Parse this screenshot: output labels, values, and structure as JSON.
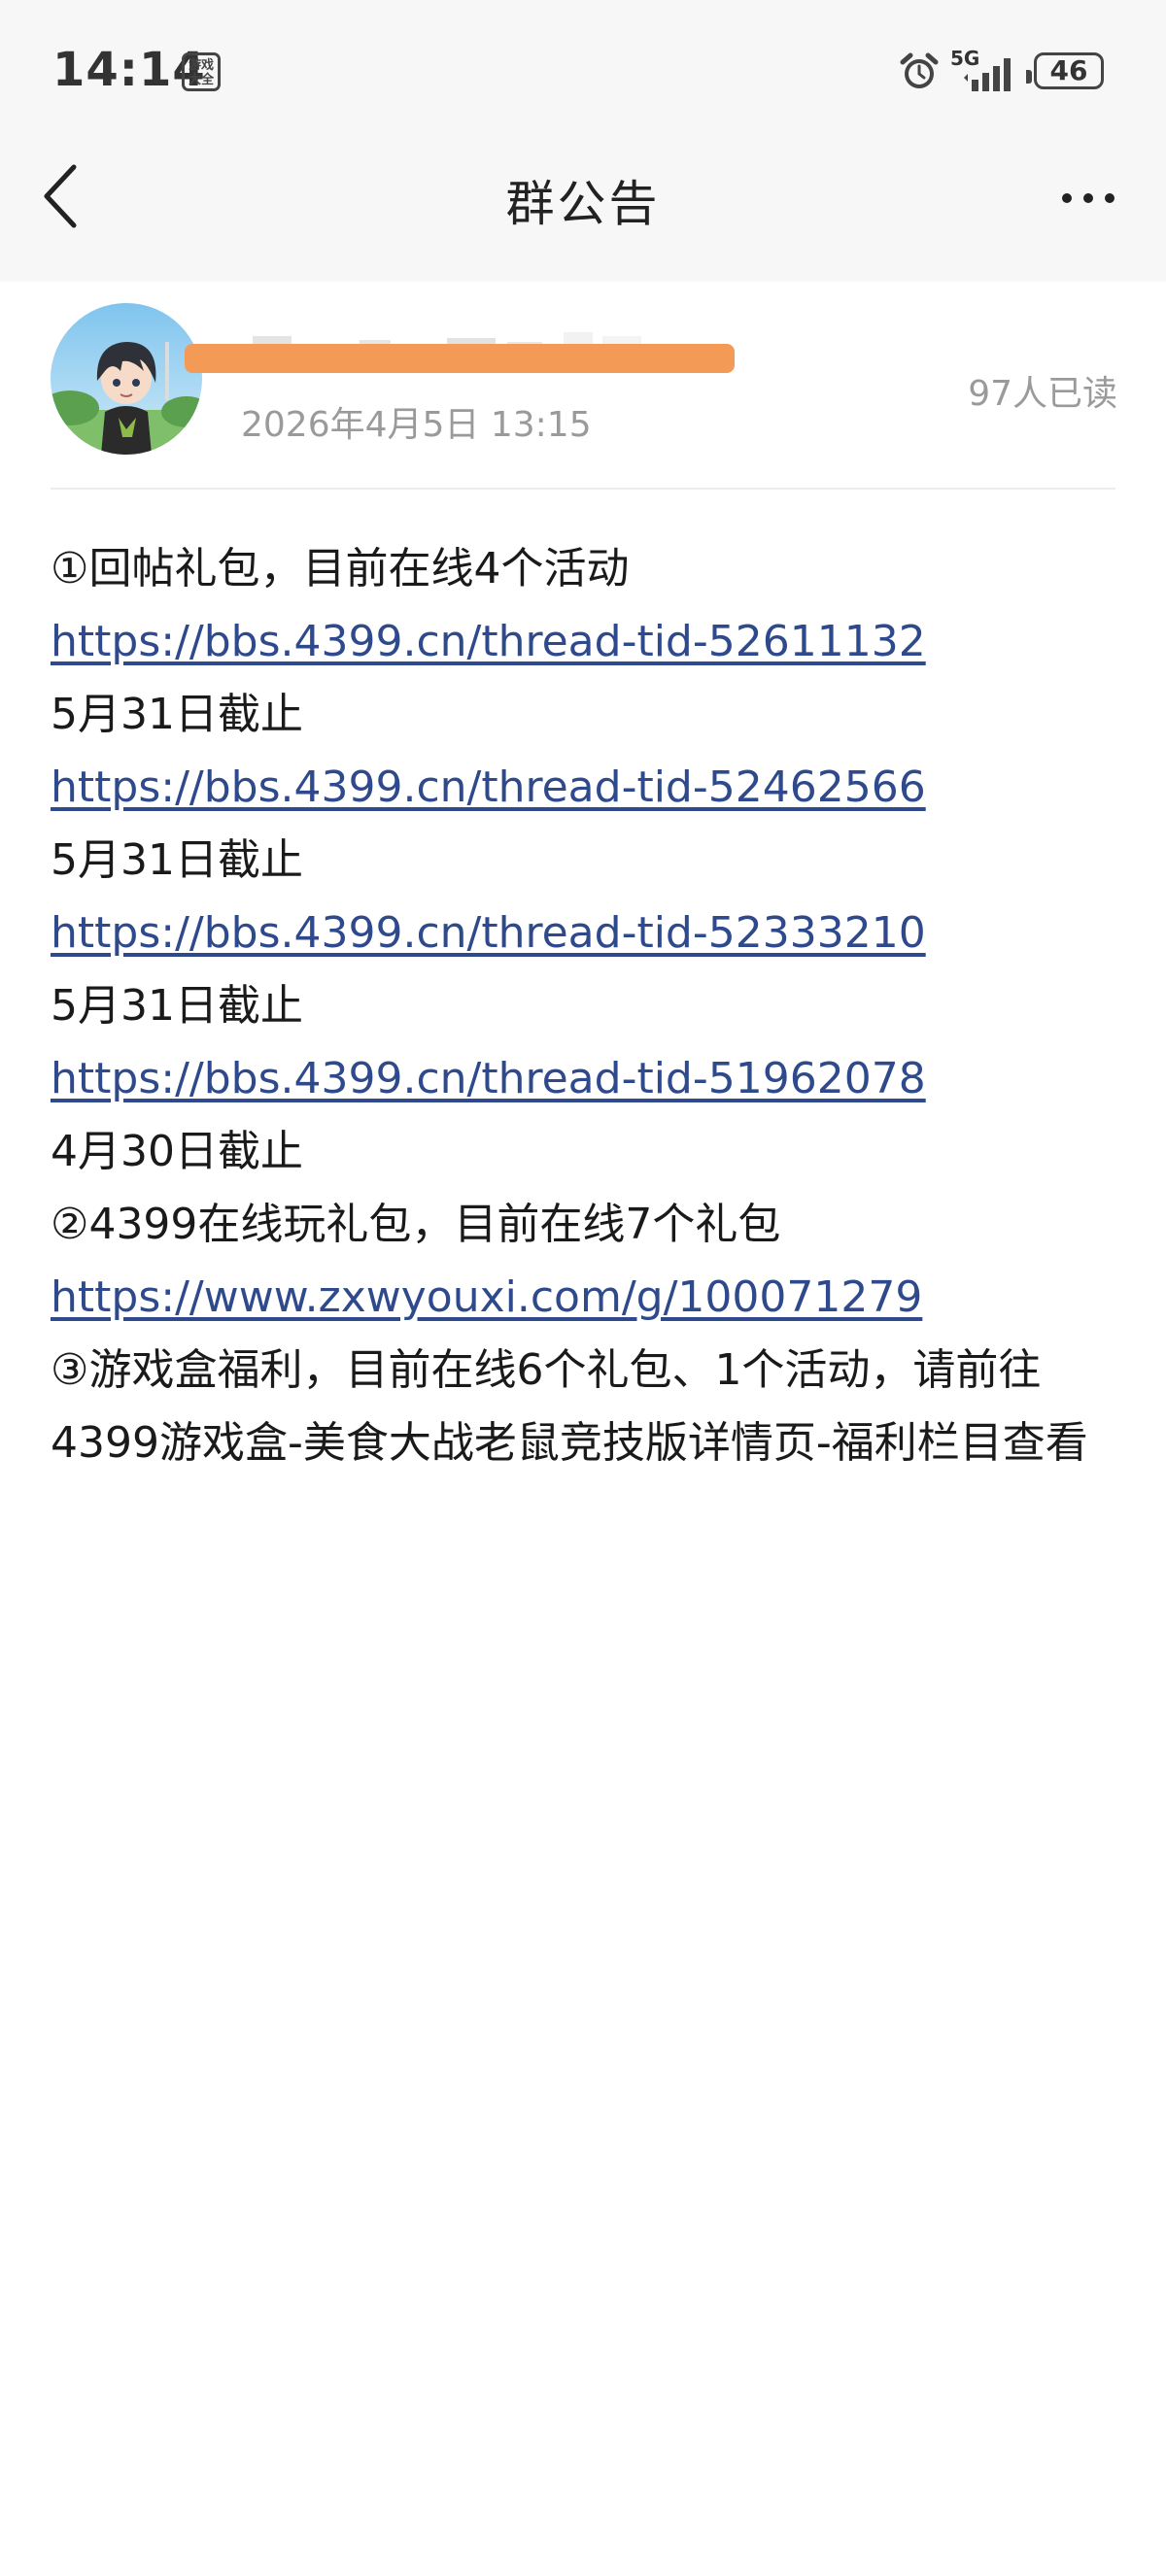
{
  "status_bar": {
    "time": "14:14",
    "app_icon_text": "游戏大全",
    "network": "5G",
    "battery": "46"
  },
  "header": {
    "title": "群公告"
  },
  "author": {
    "post_time": "2026年4月5日 13:15",
    "read_count": "97人已读"
  },
  "announcement": {
    "lines": [
      "①回帖礼包，目前在线4个活动",
      "https://bbs.4399.cn/thread-tid-52611132",
      "5月31日截止",
      "https://bbs.4399.cn/thread-tid-52462566",
      "5月31日截止",
      "https://bbs.4399.cn/thread-tid-52333210",
      "5月31日截止",
      "https://bbs.4399.cn/thread-tid-51962078",
      "4月30日截止",
      "②4399在线玩礼包，目前在线7个礼包",
      "https://www.zxwyouxi.com/g/100071279",
      "③游戏盒福利，目前在线6个礼包、1个活动，请前往4399游戏盒-美食大战老鼠竞技版详情页-福利栏目查看"
    ]
  },
  "colors": {
    "link": "#2f4a8c",
    "redaction": "#f39a57",
    "muted_text": "#9a9a9a",
    "bar_bg": "#f7f7f7"
  },
  "icons": {
    "back": "chevron-left-icon",
    "more": "more-dots-icon",
    "alarm": "alarm-clock-icon",
    "signal": "signal-bars-icon"
  }
}
